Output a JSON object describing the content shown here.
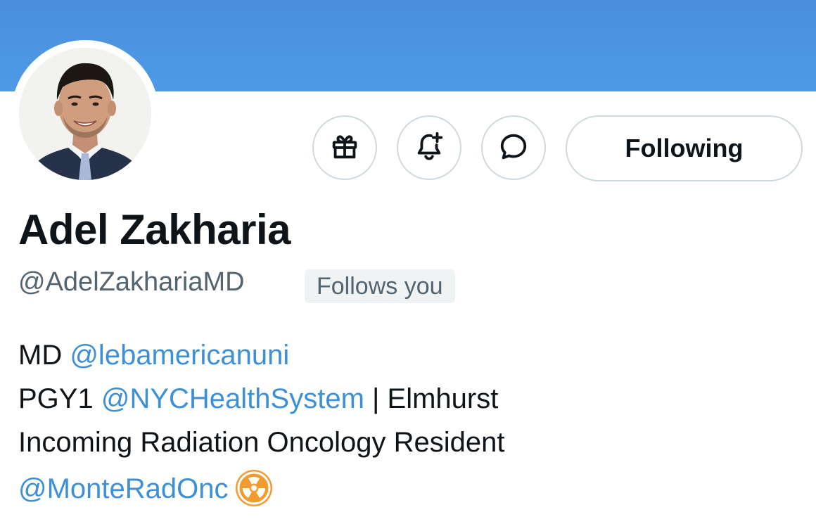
{
  "profile": {
    "display_name": "Adel Zakharia",
    "handle": "@AdelZakhariaMD",
    "follows_you_badge": "Follows you"
  },
  "actions": {
    "gift_icon": "gift-icon",
    "notify_icon": "bell-plus-icon",
    "message_icon": "message-bubble-icon",
    "follow_label": "Following"
  },
  "bio": {
    "line1_text": "MD ",
    "line1_mention": "@lebamericanuni",
    "line2_text": "PGY1 ",
    "line2_mention": "@NYCHealthSystem",
    "line2_suffix": " | Elmhurst",
    "line3_text": "Incoming Radiation Oncology Resident",
    "line4_mention": "@MonteRadOnc",
    "line4_emoji": "radioactive-emoji"
  },
  "colors": {
    "banner": "#4a8fdb",
    "mention": "#3d8fd6",
    "text": "#0f1419",
    "secondary_text": "#536471",
    "border": "#cfd9de"
  }
}
